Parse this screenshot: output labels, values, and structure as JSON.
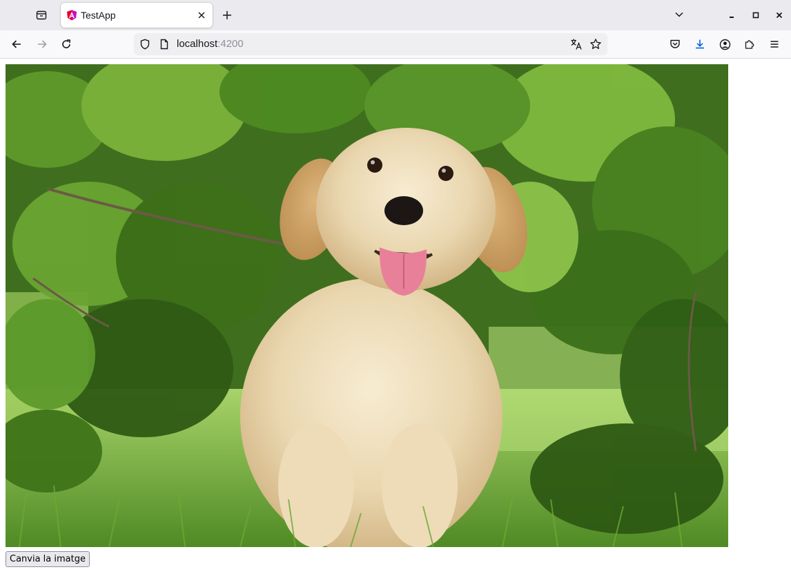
{
  "browser": {
    "tab": {
      "title": "TestApp"
    },
    "url": {
      "host": "localhost",
      "port": ":4200"
    }
  },
  "page": {
    "image": {
      "subject": "golden-retriever-puppy-photo"
    },
    "button": {
      "label": "Canvia la imatge"
    }
  },
  "colors": {
    "accent_download": "#0060df",
    "favicon_red": "#e40035",
    "favicon_magenta": "#c60fbe"
  }
}
